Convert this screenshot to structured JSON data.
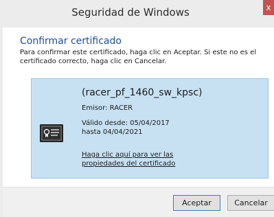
{
  "window": {
    "title": "Seguridad de Windows",
    "close_glyph": "x"
  },
  "content": {
    "heading": "Confirmar certificado",
    "instructions": "Para confirmar este certificado, haga clic en Aceptar. Si este no es el certificado correcto, haga clic en Cancelar."
  },
  "certificate": {
    "name": "(racer_pf_1460_sw_kpsc)",
    "issuer": "Emisor: RACER",
    "validity": "Válido desde: 05/04/2017 hasta 04/04/2021",
    "properties_link": "Haga clic aquí para ver las propiedades del certificado",
    "icon": "certificate-icon"
  },
  "buttons": {
    "accept": "Aceptar",
    "cancel": "Cancelar"
  },
  "colors": {
    "heading": "#1e4e9e",
    "tile_background": "#c7e1f3",
    "close_button": "#c75050"
  }
}
